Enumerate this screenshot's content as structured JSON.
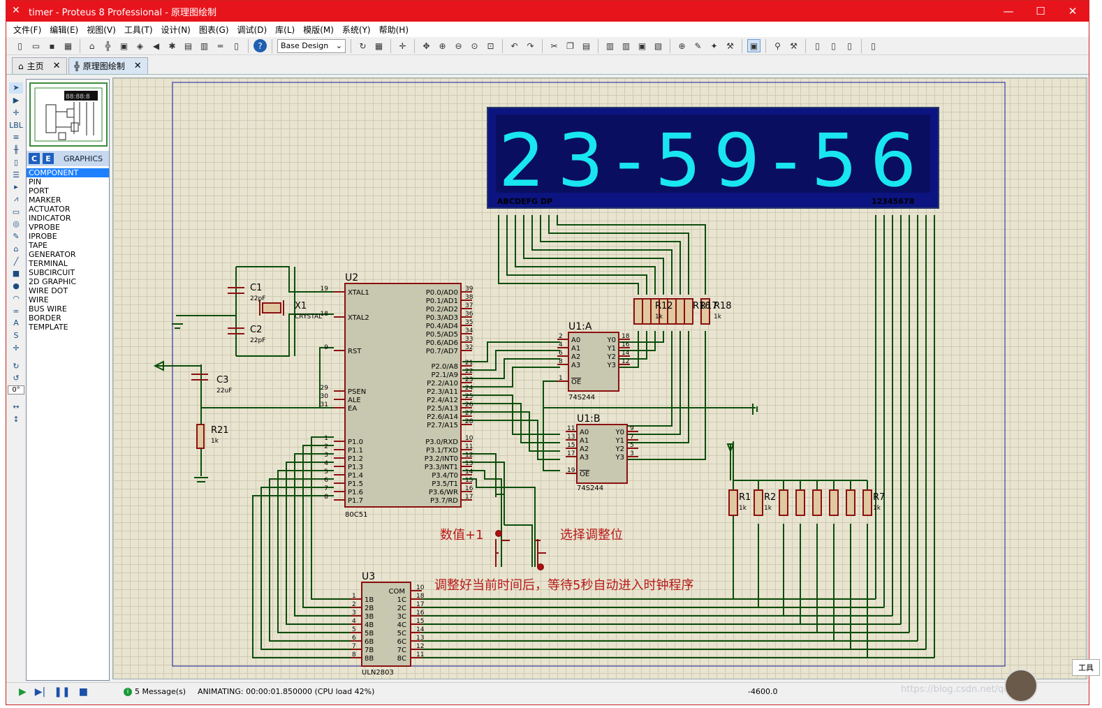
{
  "window": {
    "title": "timer - Proteus 8 Professional - 原理图绘制",
    "minimize": "—",
    "maximize": "☐",
    "close": "✕"
  },
  "menu": [
    "文件(F)",
    "编辑(E)",
    "视图(V)",
    "工具(T)",
    "设计(N)",
    "图表(G)",
    "调试(D)",
    "库(L)",
    "模版(M)",
    "系统(Y)",
    "帮助(H)"
  ],
  "toolbar": {
    "design_select": "Base Design"
  },
  "tabs": [
    {
      "label": "主页",
      "icon": "home-icon"
    },
    {
      "label": "原理图绘制",
      "icon": "schematic-icon"
    }
  ],
  "graphics_panel": {
    "btn_c": "C",
    "btn_e": "E",
    "title": "GRAPHICS",
    "items": [
      "COMPONENT",
      "PIN",
      "PORT",
      "MARKER",
      "ACTUATOR",
      "INDICATOR",
      "VPROBE",
      "IPROBE",
      "TAPE",
      "GENERATOR",
      "TERMINAL",
      "SUBCIRCUIT",
      "2D GRAPHIC",
      "WIRE DOT",
      "WIRE",
      "BUS WIRE",
      "BORDER",
      "TEMPLATE"
    ],
    "selected": "COMPONENT"
  },
  "angle": "0°",
  "schematic": {
    "display": {
      "digits": "23-59-56",
      "seg_label": "ABCDEFG  DP",
      "digit_label": "12345678"
    },
    "u2": {
      "ref": "U2",
      "part": "80C51",
      "left_pins": [
        {
          "n": "19",
          "l": "XTAL1"
        },
        {
          "n": "18",
          "l": "XTAL2"
        },
        {
          "n": "9",
          "l": "RST"
        },
        {
          "n": "29",
          "l": "PSEN"
        },
        {
          "n": "30",
          "l": "ALE"
        },
        {
          "n": "31",
          "l": "EA"
        },
        {
          "n": "1",
          "l": "P1.0"
        },
        {
          "n": "2",
          "l": "P1.1"
        },
        {
          "n": "3",
          "l": "P1.2"
        },
        {
          "n": "4",
          "l": "P1.3"
        },
        {
          "n": "5",
          "l": "P1.4"
        },
        {
          "n": "6",
          "l": "P1.5"
        },
        {
          "n": "7",
          "l": "P1.6"
        },
        {
          "n": "8",
          "l": "P1.7"
        }
      ],
      "right_pins": [
        {
          "n": "39",
          "l": "P0.0/AD0"
        },
        {
          "n": "38",
          "l": "P0.1/AD1"
        },
        {
          "n": "37",
          "l": "P0.2/AD2"
        },
        {
          "n": "36",
          "l": "P0.3/AD3"
        },
        {
          "n": "35",
          "l": "P0.4/AD4"
        },
        {
          "n": "34",
          "l": "P0.5/AD5"
        },
        {
          "n": "33",
          "l": "P0.6/AD6"
        },
        {
          "n": "32",
          "l": "P0.7/AD7"
        },
        {
          "n": "21",
          "l": "P2.0/A8"
        },
        {
          "n": "22",
          "l": "P2.1/A9"
        },
        {
          "n": "23",
          "l": "P2.2/A10"
        },
        {
          "n": "24",
          "l": "P2.3/A11"
        },
        {
          "n": "25",
          "l": "P2.4/A12"
        },
        {
          "n": "26",
          "l": "P2.5/A13"
        },
        {
          "n": "27",
          "l": "P2.6/A14"
        },
        {
          "n": "28",
          "l": "P2.7/A15"
        },
        {
          "n": "10",
          "l": "P3.0/RXD"
        },
        {
          "n": "11",
          "l": "P3.1/TXD"
        },
        {
          "n": "12",
          "l": "P3.2/INT0"
        },
        {
          "n": "13",
          "l": "P3.3/INT1"
        },
        {
          "n": "14",
          "l": "P3.4/T0"
        },
        {
          "n": "15",
          "l": "P3.5/T1"
        },
        {
          "n": "16",
          "l": "P3.6/WR"
        },
        {
          "n": "17",
          "l": "P3.7/RD"
        }
      ]
    },
    "u1a": {
      "ref": "U1:A",
      "part": "74S244",
      "in": [
        {
          "n": "2",
          "l": "A0"
        },
        {
          "n": "4",
          "l": "A1"
        },
        {
          "n": "6",
          "l": "A2"
        },
        {
          "n": "8",
          "l": "A3"
        }
      ],
      "out": [
        {
          "n": "18",
          "l": "Y0"
        },
        {
          "n": "16",
          "l": "Y1"
        },
        {
          "n": "14",
          "l": "Y2"
        },
        {
          "n": "12",
          "l": "Y3"
        }
      ],
      "oe": {
        "n": "1",
        "l": "OE"
      }
    },
    "u1b": {
      "ref": "U1:B",
      "part": "74S244",
      "in": [
        {
          "n": "11",
          "l": "A0"
        },
        {
          "n": "13",
          "l": "A1"
        },
        {
          "n": "15",
          "l": "A2"
        },
        {
          "n": "17",
          "l": "A3"
        }
      ],
      "out": [
        {
          "n": "9",
          "l": "Y0"
        },
        {
          "n": "7",
          "l": "Y1"
        },
        {
          "n": "5",
          "l": "Y2"
        },
        {
          "n": "3",
          "l": "Y3"
        }
      ],
      "oe": {
        "n": "19",
        "l": "OE"
      }
    },
    "u3": {
      "ref": "U3",
      "part": "ULN2803",
      "com": "COM",
      "in": [
        {
          "n": "1",
          "l": "1B"
        },
        {
          "n": "2",
          "l": "2B"
        },
        {
          "n": "3",
          "l": "3B"
        },
        {
          "n": "4",
          "l": "4B"
        },
        {
          "n": "5",
          "l": "5B"
        },
        {
          "n": "6",
          "l": "6B"
        },
        {
          "n": "7",
          "l": "7B"
        },
        {
          "n": "8",
          "l": "8B"
        }
      ],
      "out": [
        {
          "n": "10",
          "l": ""
        },
        {
          "n": "18",
          "l": "1C"
        },
        {
          "n": "17",
          "l": "2C"
        },
        {
          "n": "16",
          "l": "3C"
        },
        {
          "n": "15",
          "l": "4C"
        },
        {
          "n": "14",
          "l": "5C"
        },
        {
          "n": "13",
          "l": "6C"
        },
        {
          "n": "12",
          "l": "7C"
        },
        {
          "n": "11",
          "l": "8C"
        }
      ]
    },
    "c1": {
      "ref": "C1",
      "val": "22pF"
    },
    "c2": {
      "ref": "C2",
      "val": "22pF"
    },
    "c3": {
      "ref": "C3",
      "val": "22uF"
    },
    "x1": {
      "ref": "X1",
      "val": "CRYSTAL"
    },
    "r21": {
      "ref": "R21",
      "val": "1k"
    },
    "rtop": {
      "refs": [
        "R12",
        "R16",
        "R17",
        "R18"
      ],
      "val": "1k"
    },
    "rbot": {
      "first": "R1",
      "second": "R2",
      "last": "R7",
      "val": "1k"
    },
    "btn_inc": "数值+1",
    "btn_sel": "选择调整位",
    "note": "调整好当前时间后，等待5秒自动进入时钟程序"
  },
  "status": {
    "messages": "5 Message(s)",
    "animating": "ANIMATING: 00:00:01.850000 (CPU load 42%)",
    "coord": "-4600.0",
    "watermark": "https://blog.csdn.net/qq_"
  },
  "popup": "工具",
  "colors": {
    "title": "#e8141c",
    "wire": "#0b4d0b",
    "comp": "#8b1010",
    "display_bg": "#0b1480",
    "digit": "#19e6f0"
  }
}
